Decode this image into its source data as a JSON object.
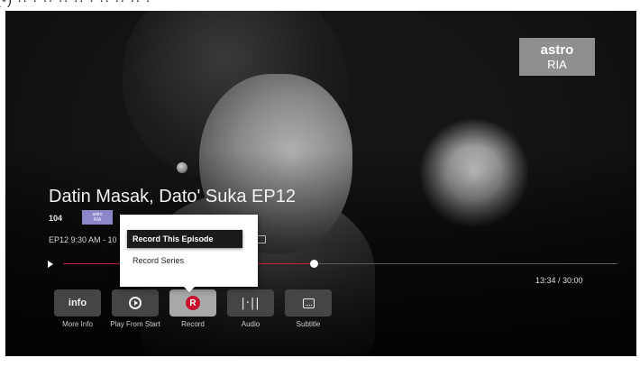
{
  "caption_fragment": "(-) ·· · ·· ·· ·· · ·· ·· ·· ·",
  "channel_logo": {
    "line1": "astro",
    "line2": "RIA"
  },
  "program": {
    "title": "Datin Masak, Dato' Suka EP12",
    "channel_number": "104",
    "channel_logo_small": {
      "line1": "astro",
      "line2": "RIA"
    },
    "time": "EP12 9:30 AM - 10"
  },
  "progress": {
    "elapsed_label": "13:34 / 30:00",
    "elapsed_fraction": 0.452,
    "bar_color": "#d0213a"
  },
  "record_popup": {
    "options": [
      "Record This Episode",
      "Record Series"
    ],
    "selected_index": 0
  },
  "controls": [
    {
      "name": "more-info",
      "icon": "info-text",
      "icon_text": "info",
      "label": "More Info",
      "active": false
    },
    {
      "name": "play-from-start",
      "icon": "replay-icon",
      "label": "Play From Start",
      "active": false
    },
    {
      "name": "record",
      "icon": "record-icon",
      "icon_text": "R",
      "label": "Record",
      "active": true
    },
    {
      "name": "audio",
      "icon": "audio-icon",
      "icon_text": "|·||",
      "label": "Audio",
      "active": false
    },
    {
      "name": "subtitle",
      "icon": "subtitle-icon",
      "label": "Subtitle",
      "active": false
    }
  ],
  "colors": {
    "record_red": "#c8102e",
    "highlight": "#1b1b1b"
  }
}
